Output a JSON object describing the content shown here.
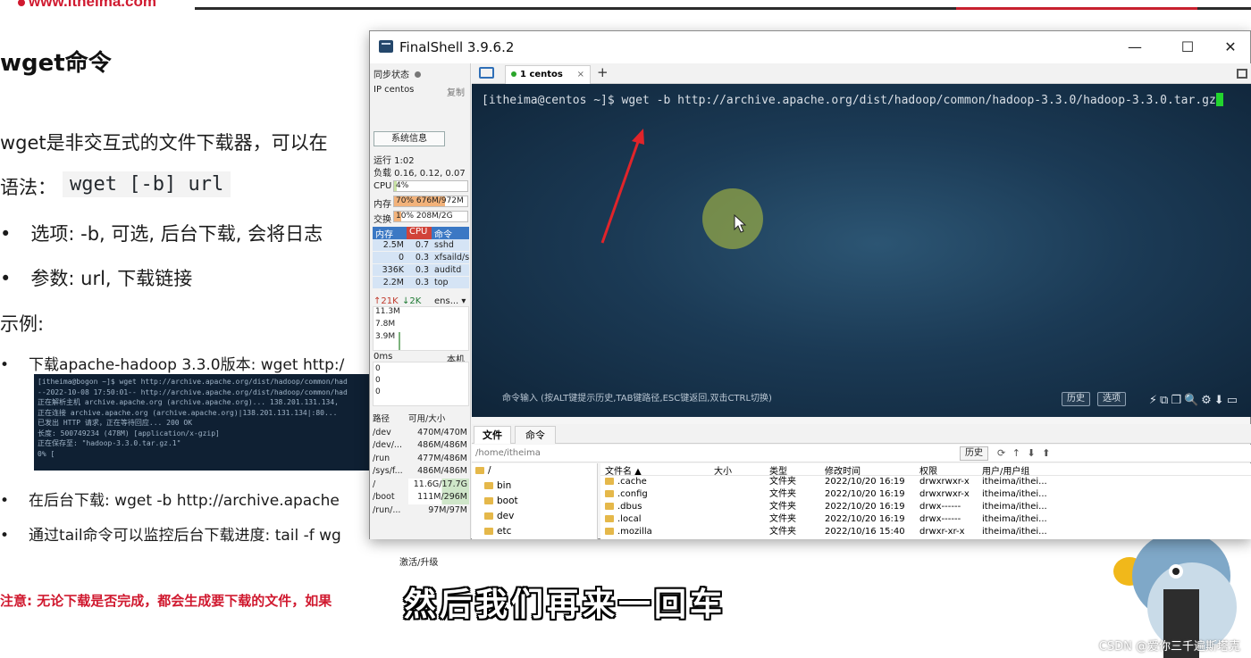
{
  "slide": {
    "logo": "www.itheima.com",
    "title": "wget命令",
    "intro": "wget是非交互式的文件下载器，可以在",
    "syntax_label": "语法：",
    "syntax_code": "wget [-b] url",
    "option": "选项: -b, 可选, 后台下载, 会将日志",
    "param": "参数: url, 下载链接",
    "example_label": "示例:",
    "example1": "下载apache-hadoop 3.3.0版本: wget http:/",
    "example2": "在后台下载: wget -b http://archive.apache",
    "example3": "通过tail命令可以监控后台下载进度: tail -f wg",
    "term_lines": [
      "[itheima@bogon ~]$ wget http://archive.apache.org/dist/hadoop/common/had",
      "--2022-10-08 17:50:01--  http://archive.apache.org/dist/hadoop/common/had",
      "正在解析主机 archive.apache.org (archive.apache.org)... 138.201.131.134,",
      "正在连接 archive.apache.org (archive.apache.org)|138.201.131.134|:80...",
      "已发出 HTTP 请求，正在等待回应... 200 OK",
      "长度: 500749234 (478M) [application/x-gzip]",
      "正在保存至: \"hadoop-3.3.0.tar.gz.1\"",
      "",
      " 0% ["
    ],
    "note": "注意: 无论下载是否完成，都会生成要下载的文件，如果",
    "subtitle": "然后我们再来一回车",
    "watermark": "CSDN @爱你三千遍斯塔克"
  },
  "window": {
    "title": "FinalShell 3.9.6.2",
    "min": "—",
    "max": "☐",
    "close": "✕"
  },
  "sidebar": {
    "sync_label": "同步状态",
    "ip_label": "IP centos",
    "copy_label": "复制",
    "sysinfo_button": "系统信息",
    "uptime": "运行 1:02",
    "load": "负载 0.16, 0.12, 0.07",
    "cpu_label": "CPU",
    "cpu_value": "4%",
    "cpu_percent": 4,
    "mem_label": "内存",
    "mem_value": "70% 676M/972M",
    "mem_percent": 70,
    "swap_label": "交换",
    "swap_value": "10%      208M/2G",
    "swap_percent": 10,
    "proc_headers": [
      "内存",
      "CPU",
      "命令"
    ],
    "processes": [
      {
        "mem": "2.5M",
        "cpu": "0.7",
        "cmd": "sshd"
      },
      {
        "mem": "0",
        "cpu": "0.3",
        "cmd": "xfsaild/s"
      },
      {
        "mem": "336K",
        "cpu": "0.3",
        "cmd": "auditd"
      },
      {
        "mem": "2.2M",
        "cpu": "0.3",
        "cmd": "top"
      }
    ],
    "net_up": "↑21K",
    "net_down": "↓2K",
    "net_iface": "ens... ▾",
    "net_scale": [
      "11.3M",
      "7.8M",
      "3.9M"
    ],
    "ping_label": "0ms",
    "ping_host": "本机",
    "ping_scale": [
      "0",
      "0",
      "0"
    ],
    "disk_headers": [
      "路径",
      "可用/大小"
    ],
    "disks": [
      {
        "path": "/dev",
        "size": "470M/470M"
      },
      {
        "path": "/dev/...",
        "size": "486M/486M"
      },
      {
        "path": "/run",
        "size": "477M/486M"
      },
      {
        "path": "/sys/f...",
        "size": "486M/486M"
      },
      {
        "path": "/",
        "size": "11.6G/17.7G"
      },
      {
        "path": "/boot",
        "size": "111M/296M"
      },
      {
        "path": "/run/...",
        "size": "97M/97M"
      }
    ],
    "activate": "激活/升级"
  },
  "tabs": {
    "session": "1 centos",
    "close": "×",
    "add": "+"
  },
  "terminal": {
    "command": "[itheima@centos ~]$ wget -b http://archive.apache.org/dist/hadoop/common/hadoop-3.3.0/hadoop-3.3.0.tar.gz",
    "input_hint": "命令输入 (按ALT键提示历史,TAB键路径,ESC键返回,双击CTRL切换)",
    "history_btn": "历史",
    "options_btn": "选项",
    "toolbar_icons": "⚡⧉❐🔍⚙⬇▭"
  },
  "file_manager": {
    "tab_files": "文件",
    "tab_commands": "命令",
    "path": "/home/itheima",
    "history_btn": "历史",
    "path_icons": "⟳ ↑ ⬇ ⬆",
    "tree": [
      "/",
      "bin",
      "boot",
      "dev",
      "etc"
    ],
    "headers": [
      "文件名 ▲",
      "大小",
      "类型",
      "修改时间",
      "权限",
      "用户/用户组"
    ],
    "rows": [
      {
        "name": ".cache",
        "size": "",
        "type": "文件夹",
        "mtime": "2022/10/20 16:19",
        "perm": "drwxrwxr-x",
        "owner": "itheima/ithei..."
      },
      {
        "name": ".config",
        "size": "",
        "type": "文件夹",
        "mtime": "2022/10/20 16:19",
        "perm": "drwxrwxr-x",
        "owner": "itheima/ithei..."
      },
      {
        "name": ".dbus",
        "size": "",
        "type": "文件夹",
        "mtime": "2022/10/20 16:19",
        "perm": "drwx------",
        "owner": "itheima/ithei..."
      },
      {
        "name": ".local",
        "size": "",
        "type": "文件夹",
        "mtime": "2022/10/20 16:19",
        "perm": "drwx------",
        "owner": "itheima/ithei..."
      },
      {
        "name": ".mozilla",
        "size": "",
        "type": "文件夹",
        "mtime": "2022/10/16 15:40",
        "perm": "drwxr-xr-x",
        "owner": "itheima/ithei..."
      }
    ]
  },
  "colors": {
    "terminal_bg": "#1b3a55",
    "cursor": "#22d52e",
    "accent": "#3b78c4",
    "note_red": "#d0192f"
  }
}
